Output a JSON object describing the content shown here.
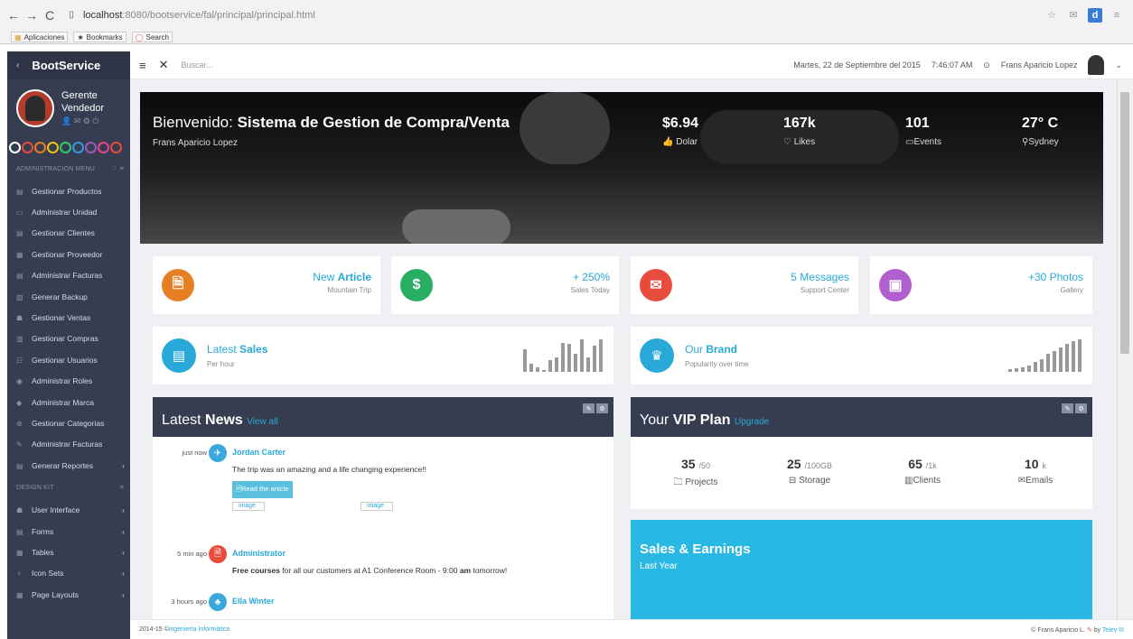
{
  "browser": {
    "url_host": "localhost",
    "url_rest": ":8080/bootservice/fal/principal/principal.html",
    "bookmarks": [
      "Aplicaciones",
      "Bookmarks",
      "Search"
    ],
    "ext_d": "d"
  },
  "sidebar": {
    "brand": "BootService",
    "profile": {
      "role1": "Gerente",
      "role2": "Vendedor"
    },
    "theme_colors": [
      "#ffffff",
      "#e74c3c",
      "#e67e22",
      "#f1c40f",
      "#2ecc71",
      "#3498db",
      "#9b59b6",
      "#e84393",
      "#e74c3c"
    ],
    "admin_title": "ADMINISTRACION MENU",
    "admin_items": [
      "Gestionar Productos",
      "Administrar Unidad",
      "Gestionar Clientes",
      "Gestionar Proveedor",
      "Administrar Facturas",
      "Generar Backup",
      "Gestionar Ventas",
      "Gestionar Compras",
      "Gestionar Usuarios",
      "Administrar Roles",
      "Administrar Marca",
      "Gestionar Categorias",
      "Administrar Facturas",
      "Generar Reportes"
    ],
    "design_title": "DESIGN KIT",
    "design_items": [
      "User Interface",
      "Forms",
      "Tables",
      "Icon Sets",
      "Page Layouts"
    ]
  },
  "topbar": {
    "search_placeholder": "Buscar...",
    "date": "Martes, 22 de Septiembre del 2015",
    "time": "7:46:07 AM",
    "user": "Frans Aparicio Lopez"
  },
  "hero": {
    "title_pre": "Bienvenido: ",
    "title_bold": "Sistema de Gestion de Compra/Venta",
    "subtitle": "Frans Aparicio Lopez",
    "stats": [
      {
        "value": "$6.94",
        "label": "Dolar"
      },
      {
        "value": "167k",
        "label": "Likes"
      },
      {
        "value": "101",
        "label": "Events"
      },
      {
        "value": "27° C",
        "label": "Sydney"
      }
    ]
  },
  "cards": [
    {
      "title_a": "New ",
      "title_b": "Article",
      "sub": "Mountain Trip",
      "color": "#e67e22"
    },
    {
      "title_a": "+ 250%",
      "title_b": "",
      "sub": "Sales Today",
      "color": "#27ae60"
    },
    {
      "title_a": "5 Messages",
      "title_b": "",
      "sub": "Support Center",
      "color": "#e74c3c"
    },
    {
      "title_a": "+30 Photos",
      "title_b": "",
      "sub": "Gallery",
      "color": "#b05fce"
    }
  ],
  "widgets": [
    {
      "title_a": "Latest ",
      "title_b": "Sales",
      "sub": "Per hour",
      "bars": [
        0.7,
        0.25,
        0.15,
        0.0,
        0.35,
        0.45,
        0.9,
        0.85,
        0.55,
        1.0,
        0.45,
        0.8,
        1.0
      ]
    },
    {
      "title_a": "Our ",
      "title_b": "Brand",
      "sub": "Popularity over time",
      "bars": [
        0.08,
        0.12,
        0.15,
        0.2,
        0.3,
        0.4,
        0.55,
        0.65,
        0.75,
        0.85,
        0.95,
        1.0
      ]
    }
  ],
  "news": {
    "title_a": "Latest ",
    "title_b": "News",
    "link": "View all",
    "items": [
      {
        "time": "just now",
        "name": "Jordan Carter",
        "msg": "The trip was an amazing and a life changing experience!!",
        "button": "Read the article",
        "images": [
          "image",
          "image"
        ],
        "color": "#3ba8dc"
      },
      {
        "time": "5 min ago",
        "name": "Administrator",
        "msg_b1": "Free courses",
        "msg_m": " for all our customers at A1 Conference Room - 9:00 ",
        "msg_b2": "am",
        "msg_e": " tomorrow!",
        "color": "#e74c3c"
      },
      {
        "time": "3 hours ago",
        "name": "Ella Winter",
        "color": "#3ba8dc"
      }
    ]
  },
  "vip": {
    "title_a": "Your ",
    "title_b": "VIP Plan",
    "link": "Upgrade",
    "stats": [
      {
        "n": "35",
        "of": "/50",
        "label": "Projects"
      },
      {
        "n": "25",
        "of": "/100GB",
        "label": "Storage"
      },
      {
        "n": "65",
        "of": "/1k",
        "label": "Clients"
      },
      {
        "n": "10",
        "of": "k",
        "label": "Emails"
      }
    ]
  },
  "sales": {
    "title": "Sales & Earnings",
    "sub": "Last Year"
  },
  "footer": {
    "left": "2014-15 © ",
    "left_link": "ingeniería Informática",
    "right": "© Frans Aparicio L.",
    "right_by": " by ",
    "right_link": "Telev III"
  }
}
